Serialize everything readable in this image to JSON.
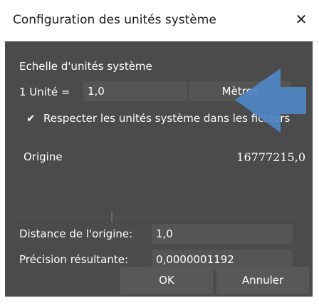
{
  "dialog": {
    "title": "Configuration des unités système",
    "close_glyph": "✕"
  },
  "scale": {
    "section_label": "Echelle d'unités système",
    "unit_label": "1 Unité =",
    "unit_value": "1,0",
    "unit_type": "Mètres"
  },
  "respect": {
    "checked": true,
    "check_glyph": "✔",
    "label": "Respecter les unités système dans les fichiers"
  },
  "origin": {
    "label": "Origine",
    "value": "16777215,0"
  },
  "distance": {
    "label": "Distance de l'origine:",
    "value": "1,0"
  },
  "precision": {
    "label": "Précision résultante:",
    "value": "0,0000001192"
  },
  "buttons": {
    "ok": "OK",
    "cancel": "Annuler"
  },
  "colors": {
    "dialog_bg": "#4b4b4b",
    "field_bg": "#555555",
    "arrow_blue": "#4f86c4"
  }
}
